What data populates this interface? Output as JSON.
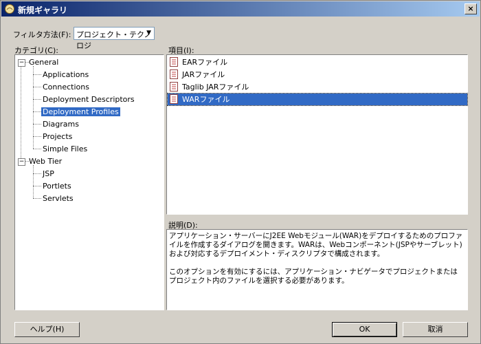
{
  "window": {
    "title": "新規ギャラリ",
    "close_glyph": "×"
  },
  "filter": {
    "label": "フィルタ方法(F):",
    "value": "プロジェクト・テクノロジ"
  },
  "categories": {
    "label": "カテゴリ(C):",
    "groups": [
      {
        "label": "General",
        "expander": "−",
        "children": [
          "Applications",
          "Connections",
          "Deployment Descriptors",
          "Deployment Profiles",
          "Diagrams",
          "Projects",
          "Simple Files"
        ]
      },
      {
        "label": "Web Tier",
        "expander": "−",
        "children": [
          "JSP",
          "Portlets",
          "Servlets"
        ]
      }
    ],
    "selected": "Deployment Profiles"
  },
  "items": {
    "label": "項目(I):",
    "list": [
      "EARファイル",
      "JARファイル",
      "Taglib JARファイル",
      "WARファイル"
    ],
    "selected": "WARファイル"
  },
  "description": {
    "label": "説明(D):",
    "text": "アプリケーション・サーバーにJ2EE Webモジュール(WAR)をデプロイするためのプロファイルを作成するダイアログを開きます。WARは、Webコンポーネント(JSPやサーブレット)および対応するデプロイメント・ディスクリプタで構成されます。\n\nこのオプションを有効にするには、アプリケーション・ナビゲータでプロジェクトまたはプロジェクト内のファイルを選択する必要があります。"
  },
  "buttons": {
    "help": "ヘルプ(H)",
    "ok": "OK",
    "cancel": "取消"
  },
  "colors": {
    "selection": "#316ac5",
    "titlebar_start": "#0a246a",
    "dialog_bg": "#d4d0c8"
  }
}
